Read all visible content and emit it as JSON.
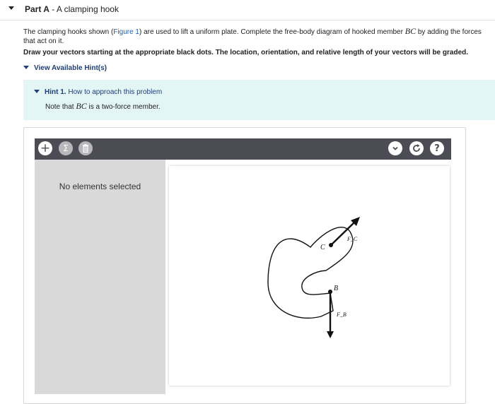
{
  "part": {
    "label": "Part A",
    "separator": " - ",
    "title": "A clamping hook"
  },
  "problem": {
    "text_before_link": "The clamping hooks shown (",
    "figure_link": "Figure 1",
    "text_after_link": ") are used to lift a uniform plate. Complete the free-body diagram of hooked member ",
    "member": "BC",
    "text_end": " by adding the forces that act on it."
  },
  "instruction": "Draw your vectors starting at the appropriate black dots. The location, orientation, and relative length of your vectors will be graded.",
  "hints": {
    "toggle_label": "View Available Hint(s)",
    "hint1": {
      "label": "Hint 1.",
      "title": "How to approach this problem",
      "body_before": "Note that ",
      "member": "BC",
      "body_after": " is a two-force member."
    }
  },
  "tool": {
    "toolbar_icons": [
      "plus-icon",
      "sigma-icon",
      "trash-icon",
      "chevron-down-icon",
      "reset-icon",
      "help-icon"
    ],
    "add_symbol": "+",
    "sum_symbol": "Σ",
    "help_symbol": "?",
    "side_panel_text": "No elements selected",
    "diagram": {
      "point_c": "C",
      "point_b": "B",
      "force_c_label": "F_C",
      "force_b_label": "F_B"
    }
  },
  "colors": {
    "toolbar": "#4c4c54",
    "side_panel": "#d9d9d9",
    "hint_background": "#e3f5f5",
    "link": "#1a5fb4",
    "hint_text": "#1f3f7a"
  }
}
